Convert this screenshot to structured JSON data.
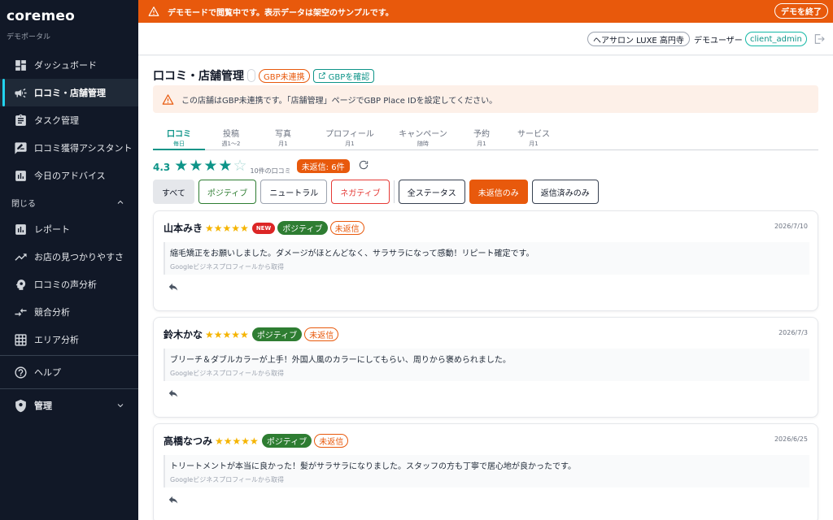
{
  "app": {
    "brand": "coremeo",
    "portal_label": "デモポータル"
  },
  "banner": {
    "message": "デモモードで閲覧中です。表示データは架空のサンプルです。",
    "end_label": "デモを終了"
  },
  "header": {
    "salon": "ヘアサロン LUXE 高円寺",
    "user_label": "デモユーザー",
    "username": "client_admin"
  },
  "sidebar": {
    "items": [
      {
        "label": "ダッシュボード",
        "icon": "dashboard-icon"
      },
      {
        "label": "口コミ・店舗管理",
        "icon": "megaphone-icon",
        "active": true
      },
      {
        "label": "タスク管理",
        "icon": "clipboard-icon"
      },
      {
        "label": "口コミ獲得アシスタント",
        "icon": "rate-review-icon"
      },
      {
        "label": "今日のアドバイス",
        "icon": "bar-chart-icon"
      }
    ],
    "section_label": "閉じる",
    "items2": [
      {
        "label": "レポート",
        "icon": "report-chart-icon"
      },
      {
        "label": "お店の見つかりやすさ",
        "icon": "trending-up-icon"
      },
      {
        "label": "口コミの声分析",
        "icon": "psychology-icon"
      },
      {
        "label": "競合分析",
        "icon": "compare-arrows-icon"
      },
      {
        "label": "エリア分析",
        "icon": "grid-icon"
      }
    ],
    "help_label": "ヘルプ",
    "admin_label": "管理"
  },
  "page": {
    "title": "口コミ・店舗管理",
    "gbp_status": "GBP未連携",
    "gbp_link": "GBPを確認",
    "alert": "この店舗はGBP未連携です。「店舗管理」ページでGBP Place IDを設定してください。"
  },
  "tabs": [
    {
      "label": "口コミ",
      "sub": "毎日",
      "active": true
    },
    {
      "label": "投稿",
      "sub": "週1〜2"
    },
    {
      "label": "写真",
      "sub": "月1"
    },
    {
      "label": "プロフィール",
      "sub": "月1"
    },
    {
      "label": "キャンペーン",
      "sub": "随時"
    },
    {
      "label": "予約",
      "sub": "月1"
    },
    {
      "label": "サービス",
      "sub": "月1"
    }
  ],
  "rating": {
    "value": "4.3",
    "stars_filled": 4,
    "stars_total": 5,
    "count_label": "10件の口コミ",
    "unreplied_label": "未返信: 6件"
  },
  "filters": {
    "sentiment": [
      "すべて",
      "ポジティブ",
      "ニュートラル",
      "ネガティブ"
    ],
    "status": [
      "全ステータス",
      "未返信のみ",
      "返信済みのみ"
    ]
  },
  "reviews": [
    {
      "name": "山本みき",
      "stars": "★★★★★",
      "new_label": "NEW",
      "sentiment": "ポジティブ",
      "status": "未返信",
      "date": "2026/7/10",
      "text": "縮毛矯正をお願いしました。ダメージがほとんどなく、サラサラになって感動！リピート確定です。",
      "source": "Googleビジネスプロフィールから取得"
    },
    {
      "name": "鈴木かな",
      "stars": "★★★★★",
      "sentiment": "ポジティブ",
      "status": "未返信",
      "date": "2026/7/3",
      "text": "ブリーチ＆ダブルカラーが上手！外国人風のカラーにしてもらい、周りから褒められました。",
      "source": "Googleビジネスプロフィールから取得"
    },
    {
      "name": "高橋なつみ",
      "stars": "★★★★★",
      "sentiment": "ポジティブ",
      "status": "未返信",
      "date": "2026/6/25",
      "text": "トリートメントが本当に良かった！髪がサラサラになりました。スタッフの方も丁寧で居心地が良かったです。",
      "source": "Googleビジネスプロフィールから取得"
    }
  ],
  "colors": {
    "accent": "#0d9488",
    "warning": "#e8590c",
    "sidebar": "#111827",
    "positive": "#2e7d32",
    "negative": "#e53935",
    "star": "#f5b400"
  }
}
